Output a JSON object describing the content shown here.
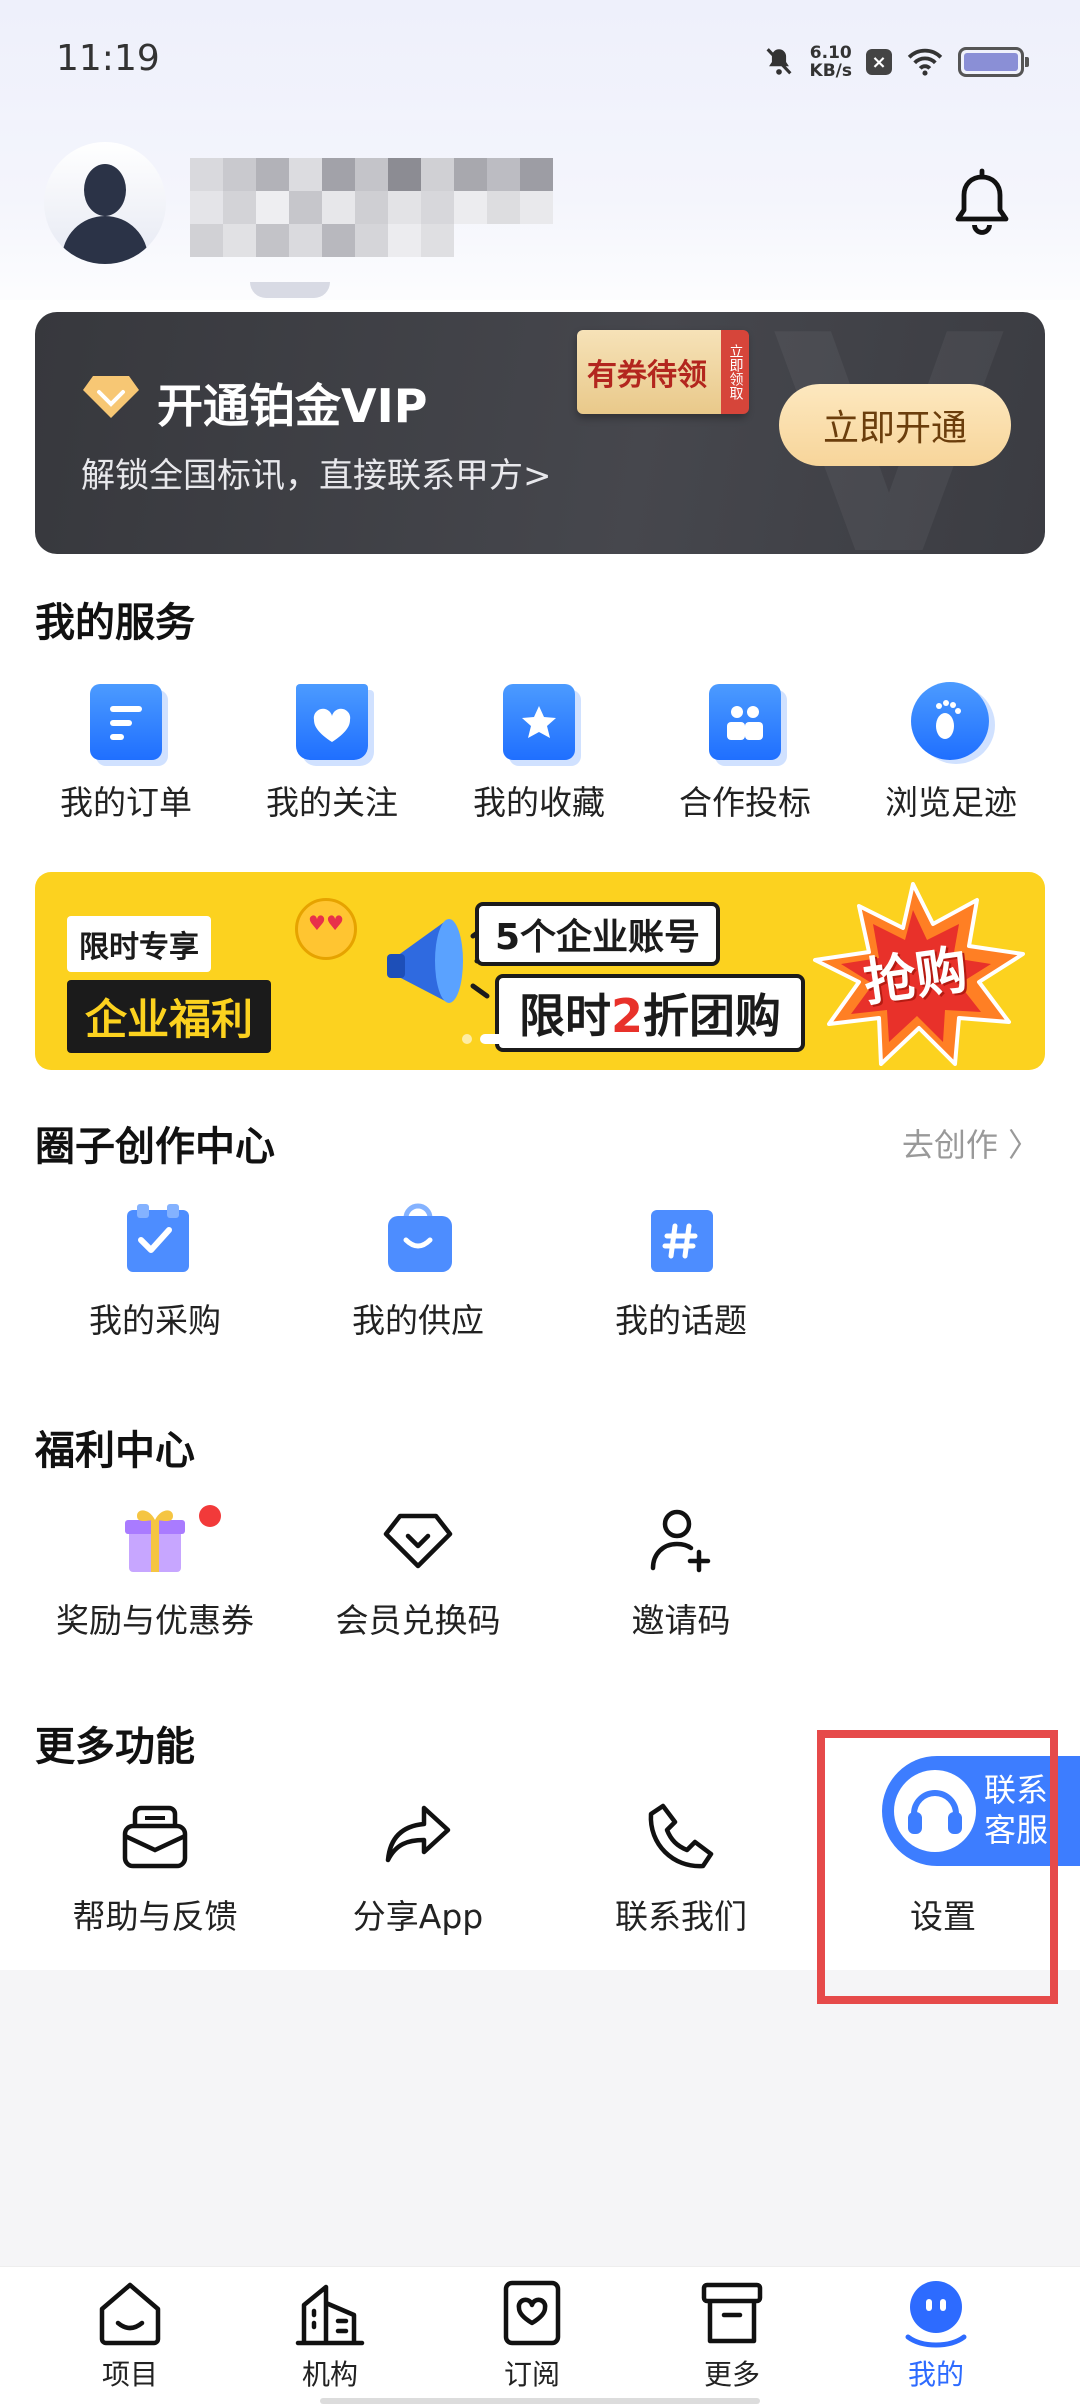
{
  "status_bar": {
    "time": "11:19",
    "net_speed_value": "6.10",
    "net_speed_unit": "KB/s",
    "battery_level": 1.0
  },
  "profile": {
    "notification_icon": "bell-icon"
  },
  "vip": {
    "title": "开通铂金VIP",
    "subtitle": "解锁全国标讯，直接联系甲方>",
    "coupon_tag": "有券待领",
    "coupon_side": "立即领取",
    "cta": "立即开通"
  },
  "services": {
    "title": "我的服务",
    "items": [
      {
        "label": "我的订单",
        "icon": "order-icon"
      },
      {
        "label": "我的关注",
        "icon": "heart-bag-icon"
      },
      {
        "label": "我的收藏",
        "icon": "star-folder-icon"
      },
      {
        "label": "合作投标",
        "icon": "team-icon"
      },
      {
        "label": "浏览足迹",
        "icon": "footprint-icon"
      }
    ]
  },
  "banner": {
    "left_top": "限时专享",
    "left_bottom": "企业福利",
    "mid_top": "5个企业账号",
    "mid_bottom_a": "限时",
    "mid_bottom_red": "2",
    "mid_bottom_b": "折团购",
    "burst": "抢购",
    "slide_count": 2,
    "active_slide": 2
  },
  "circle": {
    "title": "圈子创作中心",
    "link": "去创作 〉",
    "items": [
      {
        "label": "我的采购",
        "icon": "clipboard-check-icon"
      },
      {
        "label": "我的供应",
        "icon": "shopping-bag-icon"
      },
      {
        "label": "我的话题",
        "icon": "hashtag-icon"
      }
    ]
  },
  "welfare": {
    "title": "福利中心",
    "items": [
      {
        "label": "奖励与优惠券",
        "icon": "gift-icon"
      },
      {
        "label": "会员兑换码",
        "icon": "diamond-icon"
      },
      {
        "label": "邀请码",
        "icon": "add-user-icon"
      }
    ]
  },
  "more": {
    "title": "更多功能",
    "items": [
      {
        "label": "帮助与反馈",
        "icon": "feedback-icon"
      },
      {
        "label": "分享App",
        "icon": "share-icon"
      },
      {
        "label": "联系我们",
        "icon": "phone-icon"
      },
      {
        "label": "设置",
        "icon": "settings-icon"
      }
    ]
  },
  "customer_service": {
    "line1": "联系",
    "line2": "客服"
  },
  "bottom_nav": [
    {
      "label": "项目",
      "icon": "home-icon"
    },
    {
      "label": "机构",
      "icon": "building-icon"
    },
    {
      "label": "订阅",
      "icon": "subscribe-icon"
    },
    {
      "label": "更多",
      "icon": "archive-icon"
    },
    {
      "label": "我的",
      "icon": "profile-icon",
      "active": true
    }
  ],
  "colors": {
    "accent": "#2d6bff",
    "vip_gold": "#f7d59a",
    "banner_yellow": "#fcd21f",
    "alert_red": "#e64a4a"
  }
}
